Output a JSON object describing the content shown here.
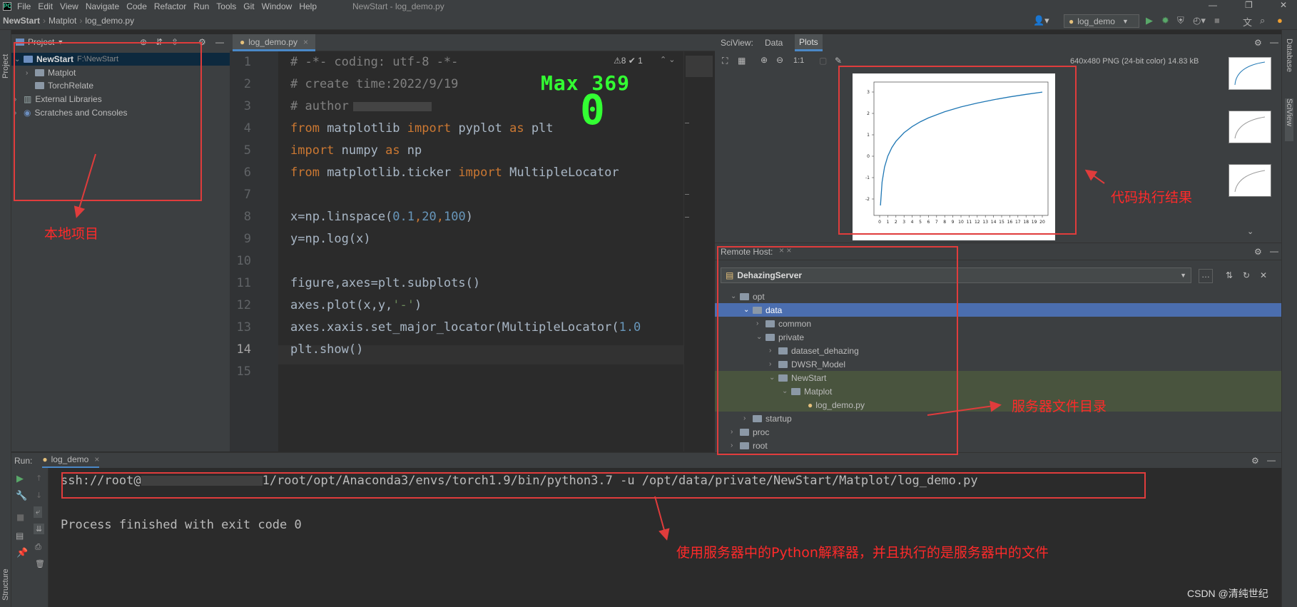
{
  "menubar": {
    "items": [
      "File",
      "Edit",
      "View",
      "Navigate",
      "Code",
      "Refactor",
      "Run",
      "Tools",
      "Git",
      "Window",
      "Help"
    ],
    "window_title": "NewStart - log_demo.py"
  },
  "navbar": {
    "breadcrumbs": [
      "NewStart",
      "Matplot",
      "log_demo.py"
    ],
    "run_config": "log_demo"
  },
  "left_strip": {
    "project_label": "Project",
    "structure_label": "Structure"
  },
  "project": {
    "header": "Project",
    "root_name": "NewStart",
    "root_path": "F:\\NewStart",
    "items": [
      "Matplot",
      "TorchRelate",
      "External Libraries",
      "Scratches and Consoles"
    ]
  },
  "editor": {
    "tab": "log_demo.py",
    "inspection": "⚠8 ✔ 1",
    "max_label": "Max 369",
    "max_value": "0",
    "line_numbers": [
      "1",
      "2",
      "3",
      "4",
      "5",
      "6",
      "7",
      "8",
      "9",
      "10",
      "11",
      "12",
      "13",
      "14",
      "15"
    ],
    "code": {
      "l1": "# -*- coding: utf-8 -*-",
      "l2": "# create time:2022/9/19",
      "l3": "# author",
      "l4a": "from",
      "l4b": " matplotlib ",
      "l4c": "import",
      "l4d": " pyplot ",
      "l4e": "as",
      "l4f": " plt",
      "l5a": "import",
      "l5b": " numpy ",
      "l5c": "as",
      "l5d": " np",
      "l6a": "from",
      "l6b": " matplotlib.ticker ",
      "l6c": "import",
      "l6d": " MultipleLocator",
      "l8a": "x=np.linspace(",
      "l8b": "0.1",
      "l8c": ",",
      "l8d": "20",
      "l8e": ",",
      "l8f": "100",
      "l8g": ")",
      "l9": "y=np.log(x)",
      "l11": "figure,axes=plt.subplots()",
      "l12a": "axes.plot(x,y,",
      "l12b": "'-'",
      "l12c": ")",
      "l13a": "axes.xaxis.set_major_locator(MultipleLocator(",
      "l13b": "1.0",
      "l14": "plt.show()"
    }
  },
  "sciview": {
    "title": "SciView:",
    "tabs": [
      "Data",
      "Plots"
    ],
    "image_info": "640x480 PNG (24-bit color) 14.83 kB",
    "zoom_label": "1:1"
  },
  "chart_data": {
    "type": "line",
    "x_ticks": [
      "0",
      "1",
      "2",
      "3",
      "4",
      "5",
      "6",
      "7",
      "8",
      "9",
      "10",
      "11",
      "12",
      "13",
      "14",
      "15",
      "16",
      "17",
      "18",
      "19",
      "20"
    ],
    "y_ticks": [
      "3",
      "2",
      "1",
      "0",
      "-1",
      "-2"
    ],
    "xlim": [
      0,
      20
    ],
    "ylim": [
      -2.5,
      3.2
    ],
    "x": [
      0.1,
      0.3,
      0.6,
      1,
      1.5,
      2,
      3,
      4,
      5,
      6,
      8,
      10,
      12,
      14,
      16,
      18,
      20
    ],
    "y": [
      -2.303,
      -1.204,
      -0.511,
      0,
      0.405,
      0.693,
      1.099,
      1.386,
      1.609,
      1.792,
      2.079,
      2.303,
      2.485,
      2.639,
      2.773,
      2.89,
      2.996
    ],
    "color": "#1f77b4"
  },
  "remote": {
    "header": "Remote Host:",
    "server": "DehazingServer",
    "tree": [
      "opt",
      "data",
      "common",
      "private",
      "dataset_dehazing",
      "DWSR_Model",
      "NewStart",
      "Matplot",
      "log_demo.py",
      "startup",
      "proc",
      "root"
    ]
  },
  "run": {
    "label": "Run:",
    "tab": "log_demo",
    "cmd_a": "ssh://root@",
    "cmd_b": "1/root/opt/Anaconda3/envs/torch1.9/bin/python3.7 -u /opt/data/private/NewStart/Matplot/log_demo.py",
    "finished": "Process finished with exit code 0"
  },
  "right_strip": {
    "database": "Database",
    "sciview": "SciView"
  },
  "annotations": {
    "local_project": "本地项目",
    "code_result": "代码执行结果",
    "server_dir": "服务器文件目录",
    "interpreter": "使用服务器中的Python解释器，并且执行的是服务器中的文件"
  },
  "watermark": "CSDN @清纯世纪",
  "colors": {
    "accent": "#4a88c7",
    "annotation": "#e03c3c"
  }
}
